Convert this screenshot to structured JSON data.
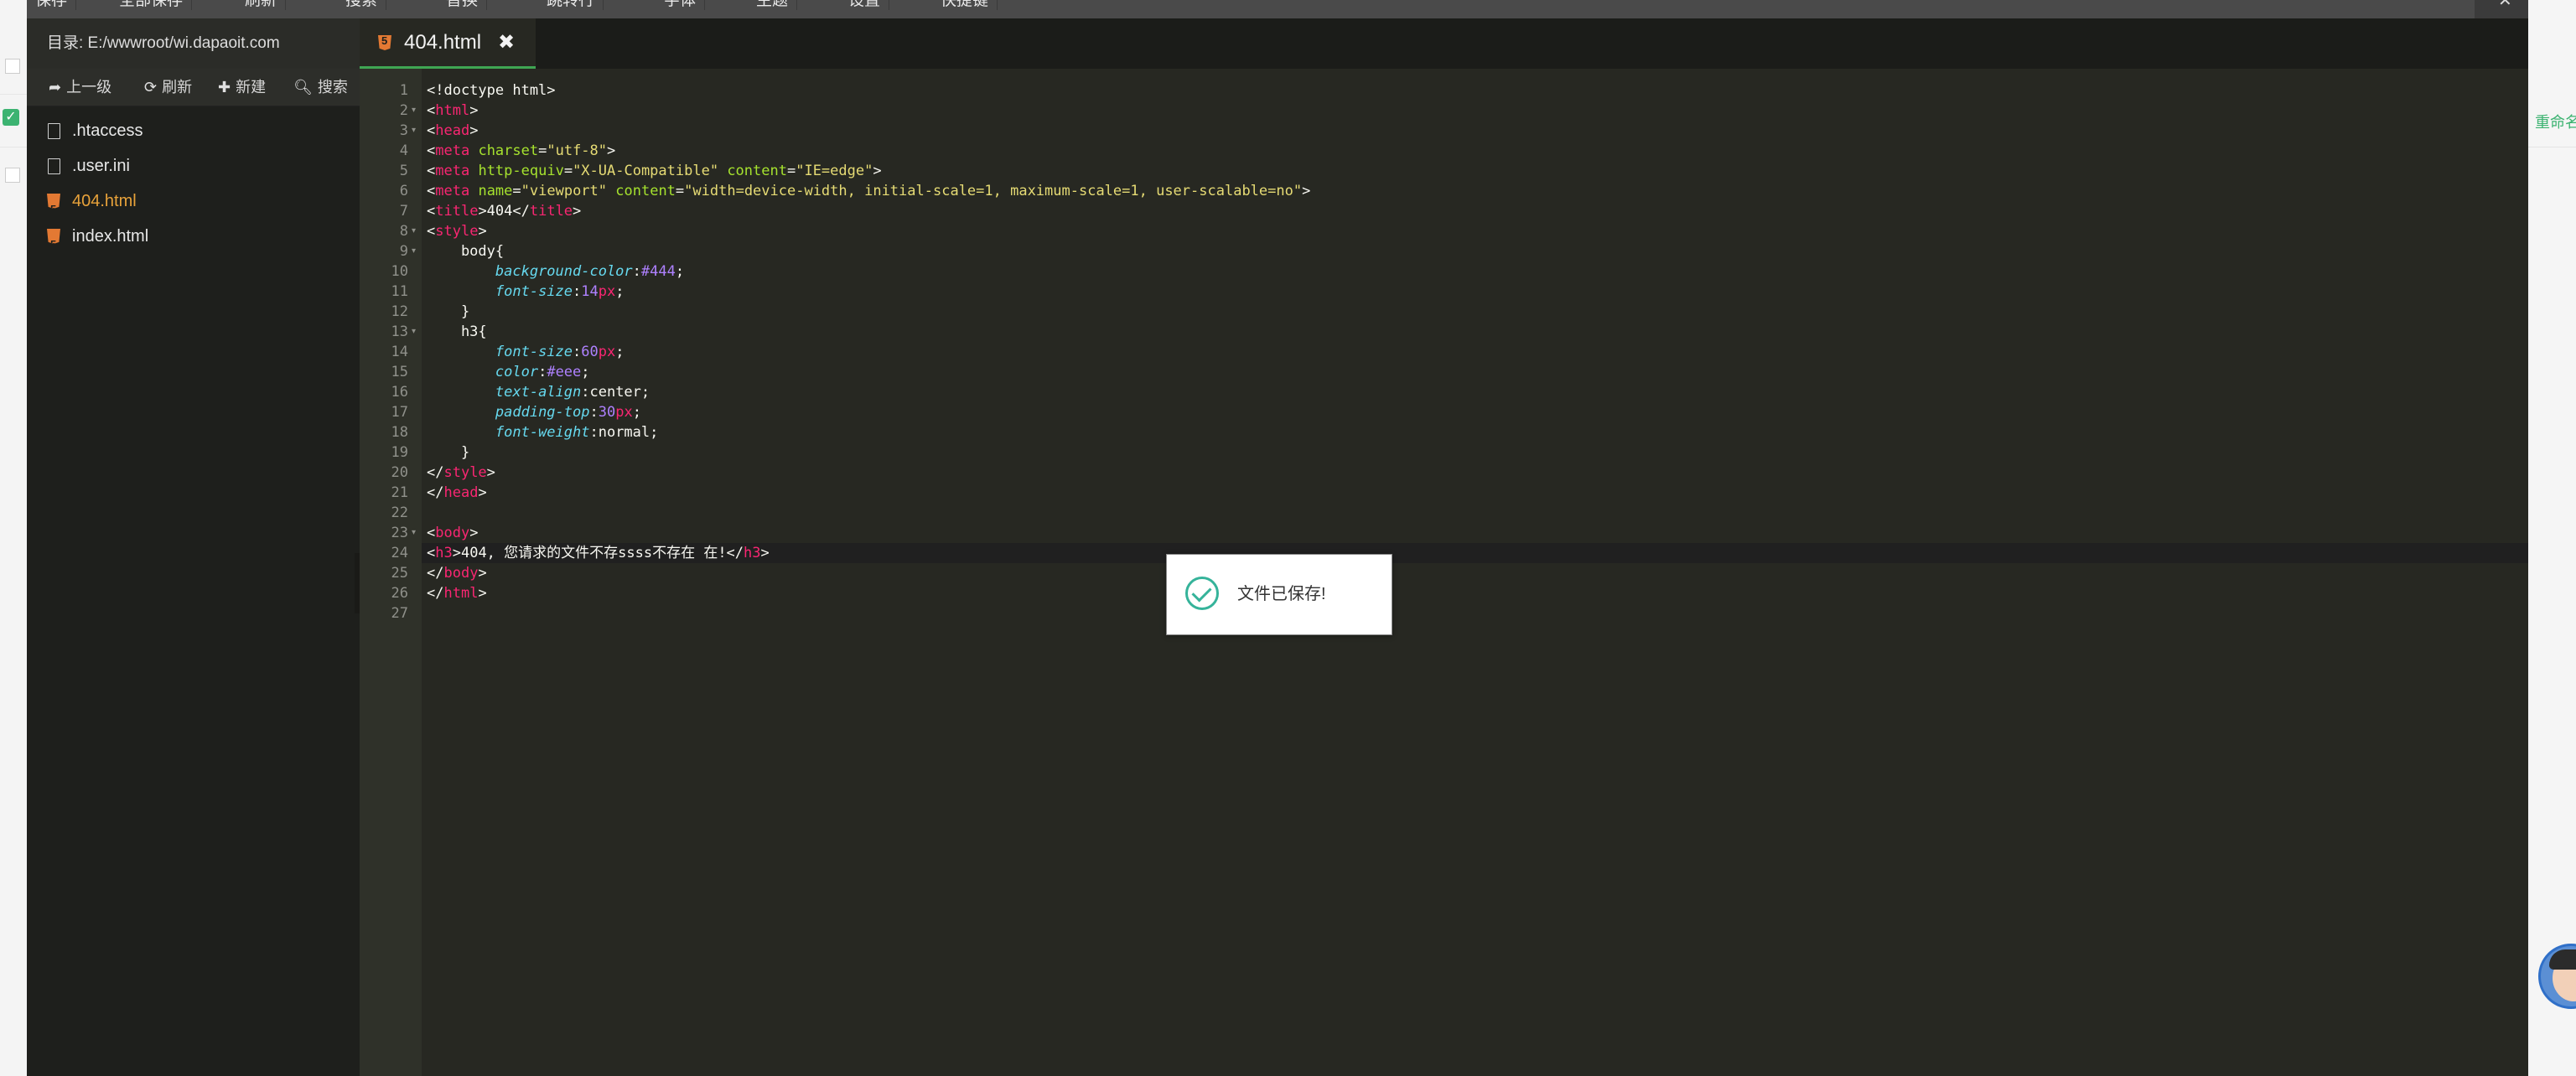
{
  "toolbar": {
    "items": [
      "保存",
      "全部保存",
      "刷新",
      "搜索",
      "替换",
      "跳转行",
      "字体",
      "主题",
      "设置",
      "快捷键"
    ]
  },
  "sidebar": {
    "dir_label": "目录: E:/wwwroot/wi.dapaoit.com",
    "tools": {
      "up": "上一级",
      "refresh": "刷新",
      "new": "新建",
      "search": "搜索"
    },
    "files": [
      {
        "name": ".htaccess",
        "type": "file"
      },
      {
        "name": ".user.ini",
        "type": "file"
      },
      {
        "name": "404.html",
        "type": "html",
        "active": true
      },
      {
        "name": "index.html",
        "type": "html"
      }
    ]
  },
  "tabs": [
    {
      "label": "404.html",
      "close": "✖"
    }
  ],
  "code": {
    "line_numbers": [
      "1",
      "2",
      "3",
      "4",
      "5",
      "6",
      "7",
      "8",
      "9",
      "10",
      "11",
      "12",
      "13",
      "14",
      "15",
      "16",
      "17",
      "18",
      "19",
      "20",
      "21",
      "22",
      "23",
      "24",
      "25",
      "26",
      "27"
    ],
    "lines": [
      [
        [
          "t-w",
          "<!doctype html>"
        ]
      ],
      [
        [
          "t-w",
          "<"
        ],
        [
          "t-tag",
          "html"
        ],
        [
          "t-w",
          ">"
        ]
      ],
      [
        [
          "t-w",
          "<"
        ],
        [
          "t-tag",
          "head"
        ],
        [
          "t-w",
          ">"
        ]
      ],
      [
        [
          "t-w",
          "<"
        ],
        [
          "t-tag",
          "meta"
        ],
        [
          "t-w",
          " "
        ],
        [
          "t-attr",
          "charset"
        ],
        [
          "t-w",
          "="
        ],
        [
          "t-str",
          "\"utf-8\""
        ],
        [
          "t-w",
          ">"
        ]
      ],
      [
        [
          "t-w",
          "<"
        ],
        [
          "t-tag",
          "meta"
        ],
        [
          "t-w",
          " "
        ],
        [
          "t-attr",
          "http-equiv"
        ],
        [
          "t-w",
          "="
        ],
        [
          "t-str",
          "\"X-UA-Compatible\""
        ],
        [
          "t-w",
          " "
        ],
        [
          "t-attr",
          "content"
        ],
        [
          "t-w",
          "="
        ],
        [
          "t-str",
          "\"IE=edge\""
        ],
        [
          "t-w",
          ">"
        ]
      ],
      [
        [
          "t-w",
          "<"
        ],
        [
          "t-tag",
          "meta"
        ],
        [
          "t-w",
          " "
        ],
        [
          "t-attr",
          "name"
        ],
        [
          "t-w",
          "="
        ],
        [
          "t-str",
          "\"viewport\""
        ],
        [
          "t-w",
          " "
        ],
        [
          "t-attr",
          "content"
        ],
        [
          "t-w",
          "="
        ],
        [
          "t-str",
          "\"width=device-width, initial-scale=1, maximum-scale=1, user-scalable=no\""
        ],
        [
          "t-w",
          ">"
        ]
      ],
      [
        [
          "t-w",
          "<"
        ],
        [
          "t-tag",
          "title"
        ],
        [
          "t-w",
          ">404</"
        ],
        [
          "t-tag",
          "title"
        ],
        [
          "t-w",
          ">"
        ]
      ],
      [
        [
          "t-w",
          "<"
        ],
        [
          "t-tag",
          "style"
        ],
        [
          "t-w",
          ">"
        ]
      ],
      [
        [
          "t-w",
          "    body{"
        ]
      ],
      [
        [
          "t-w",
          "        "
        ],
        [
          "t-prop",
          "background-color"
        ],
        [
          "t-w",
          ":"
        ],
        [
          "t-num",
          "#444"
        ],
        [
          "t-w",
          ";"
        ]
      ],
      [
        [
          "t-w",
          "        "
        ],
        [
          "t-prop",
          "font-size"
        ],
        [
          "t-w",
          ":"
        ],
        [
          "t-num",
          "14"
        ],
        [
          "t-unit",
          "px"
        ],
        [
          "t-w",
          ";"
        ]
      ],
      [
        [
          "t-w",
          "    }"
        ]
      ],
      [
        [
          "t-w",
          "    h3{"
        ]
      ],
      [
        [
          "t-w",
          "        "
        ],
        [
          "t-prop",
          "font-size"
        ],
        [
          "t-w",
          ":"
        ],
        [
          "t-num",
          "60"
        ],
        [
          "t-unit",
          "px"
        ],
        [
          "t-w",
          ";"
        ]
      ],
      [
        [
          "t-w",
          "        "
        ],
        [
          "t-prop",
          "color"
        ],
        [
          "t-w",
          ":"
        ],
        [
          "t-num",
          "#eee"
        ],
        [
          "t-w",
          ";"
        ]
      ],
      [
        [
          "t-w",
          "        "
        ],
        [
          "t-prop",
          "text-align"
        ],
        [
          "t-w",
          ":center;"
        ]
      ],
      [
        [
          "t-w",
          "        "
        ],
        [
          "t-prop",
          "padding-top"
        ],
        [
          "t-w",
          ":"
        ],
        [
          "t-num",
          "30"
        ],
        [
          "t-unit",
          "px"
        ],
        [
          "t-w",
          ";"
        ]
      ],
      [
        [
          "t-w",
          "        "
        ],
        [
          "t-prop",
          "font-weight"
        ],
        [
          "t-w",
          ":normal;"
        ]
      ],
      [
        [
          "t-w",
          "    }"
        ]
      ],
      [
        [
          "t-w",
          "</"
        ],
        [
          "t-tag",
          "style"
        ],
        [
          "t-w",
          ">"
        ]
      ],
      [
        [
          "t-w",
          "</"
        ],
        [
          "t-tag",
          "head"
        ],
        [
          "t-w",
          ">"
        ]
      ],
      [
        [
          "t-w",
          ""
        ]
      ],
      [
        [
          "t-w",
          "<"
        ],
        [
          "t-tag",
          "body"
        ],
        [
          "t-w",
          ">"
        ]
      ],
      [
        [
          "t-w",
          "<"
        ],
        [
          "t-tag",
          "h3"
        ],
        [
          "t-w",
          ">404, 您请求的文件不存ssss不存在 在!</"
        ],
        [
          "t-tag",
          "h3"
        ],
        [
          "t-w",
          ">"
        ]
      ],
      [
        [
          "t-w",
          "</"
        ],
        [
          "t-tag",
          "body"
        ],
        [
          "t-w",
          ">"
        ]
      ],
      [
        [
          "t-w",
          "</"
        ],
        [
          "t-tag",
          "html"
        ],
        [
          "t-w",
          ">"
        ]
      ],
      [
        [
          "t-w",
          ""
        ]
      ]
    ],
    "foldable_lines": [
      2,
      3,
      8,
      9,
      13,
      23
    ],
    "active_line": 24
  },
  "toast": {
    "message": "文件已保存!"
  },
  "background_page": {
    "right_link": "重命名"
  },
  "colors": {
    "editor_bg": "#272822",
    "tag": "#f92672",
    "attr": "#a6e22e",
    "string": "#e6db74",
    "property": "#66d9ef",
    "number": "#ae81ff",
    "active_file": "#e8a23a",
    "success": "#35b39a"
  }
}
